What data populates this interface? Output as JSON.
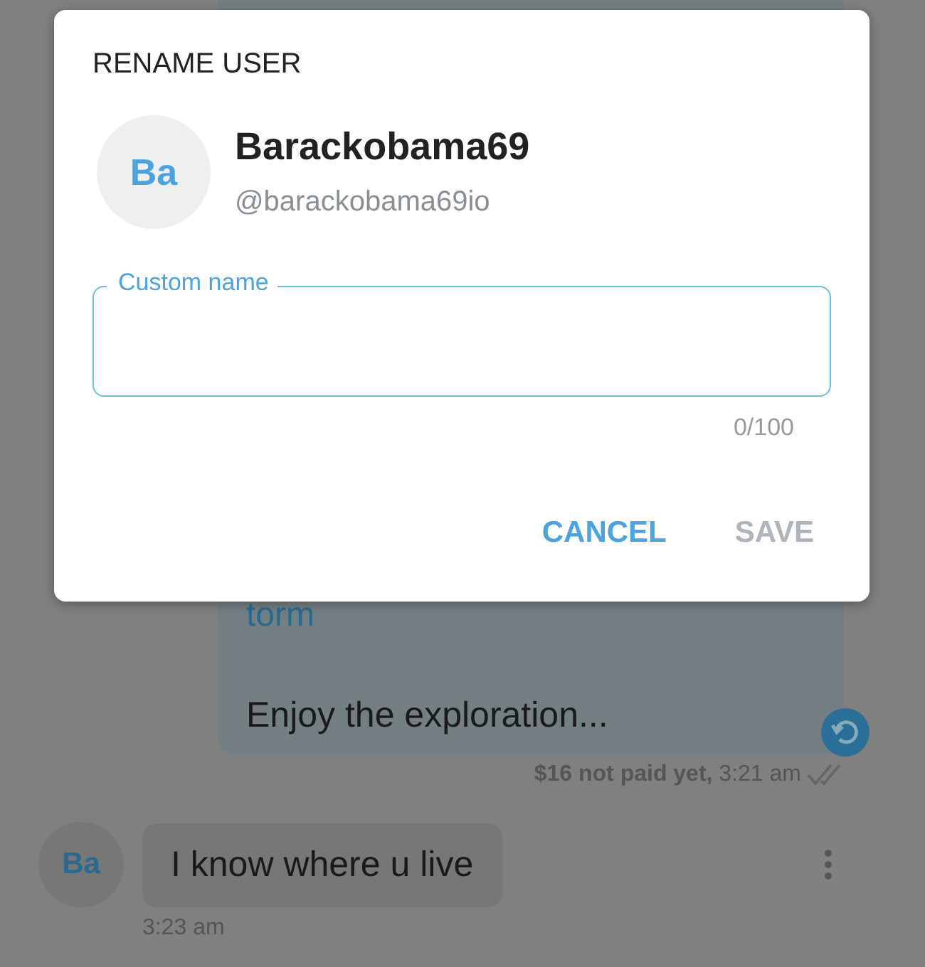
{
  "chat": {
    "messages": [
      {
        "kind": "sent",
        "link": "torm",
        "text": "Enjoy the exploration...",
        "status": "**$16 not paid yet,** 3:21 am",
        "read": true
      },
      {
        "kind": "received",
        "initials": "Ba",
        "text": "I know where u live",
        "time": "3:23 am"
      }
    ]
  },
  "dialog": {
    "title": "RENAME USER",
    "user": {
      "initials": "Ba",
      "name": "Barackobama69",
      "handle": "@barackobama69io"
    },
    "field": {
      "label": "Custom name",
      "counter": "0/100"
    },
    "buttons": [
      {
        "label": "CANCEL",
        "disabled": false
      },
      {
        "label": "SAVE",
        "disabled": true
      }
    ]
  }
}
